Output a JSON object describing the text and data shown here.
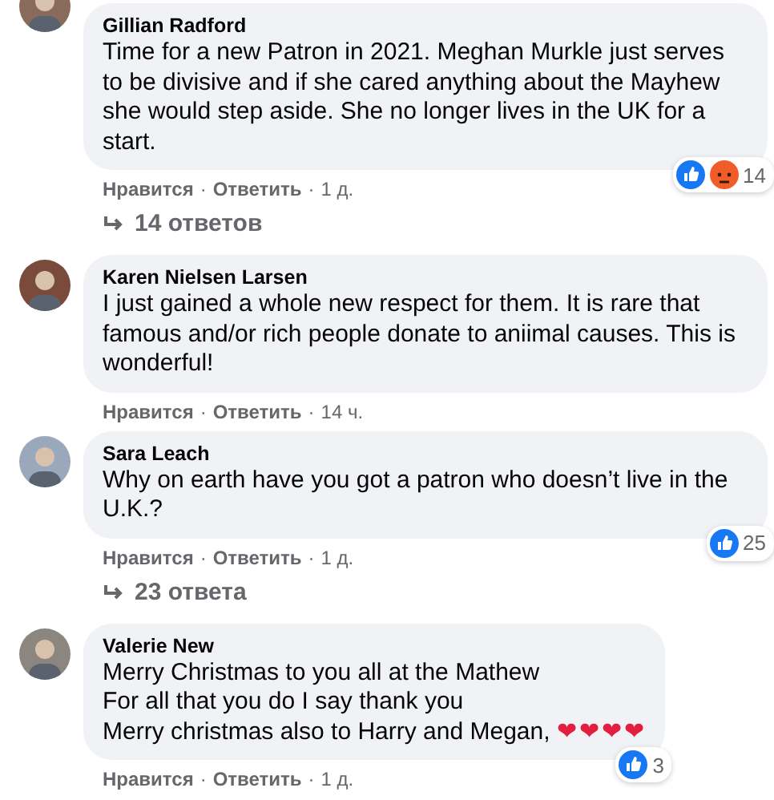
{
  "comments": [
    {
      "author": "Gillian Radford",
      "lines": [
        "Time for a new Patron in 2021. Meghan Murkle just serves to be divisive and if she cared anything about the Mayhew she would step aside. She no longer lives in the UK for a start."
      ],
      "reactions": [
        {
          "kind": "like"
        },
        {
          "kind": "angry"
        }
      ],
      "reaction_count": "14",
      "actions": {
        "like": "Нравится",
        "separator": "·",
        "reply": "Ответить",
        "time": "1 д."
      },
      "replies": "14 ответов"
    },
    {
      "author": "Karen Nielsen Larsen",
      "lines": [
        "I just gained a whole new respect for them. It is rare that famous and/or rich people donate to aniimal causes. This is wonderful!"
      ],
      "actions": {
        "like": "Нравится",
        "separator": "·",
        "reply": "Ответить",
        "time": "14 ч."
      }
    },
    {
      "author": "Sara Leach",
      "lines": [
        "Why on earth have you got a patron who doesn’t live in the U.K.?"
      ],
      "reactions": [
        {
          "kind": "like"
        }
      ],
      "reaction_count": "25",
      "actions": {
        "like": "Нравится",
        "separator": "·",
        "reply": "Ответить",
        "time": "1 д."
      },
      "replies": "23 ответа"
    },
    {
      "author": "Valerie New",
      "lines": [
        "Merry Christmas to you all at the Mathew",
        "For all that you do I say thank you",
        "Merry christmas also to Harry and Megan,"
      ],
      "hearts": "❤❤❤❤",
      "reactions": [
        {
          "kind": "like"
        }
      ],
      "reaction_count": "3",
      "actions": {
        "like": "Нравится",
        "separator": "·",
        "reply": "Ответить",
        "time": "1 д."
      }
    }
  ]
}
